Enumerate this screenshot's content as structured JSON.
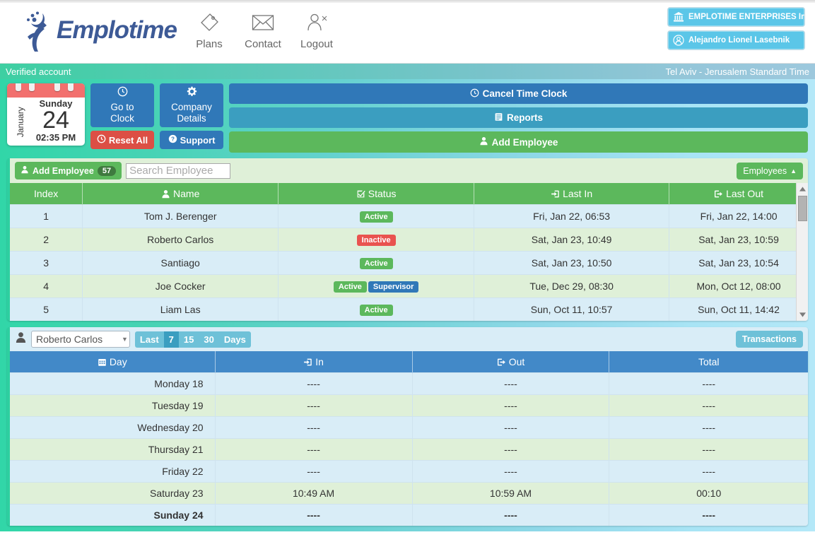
{
  "header": {
    "logo_text": "Emplotime",
    "nav": [
      {
        "label": "Plans",
        "icon": "tag-icon"
      },
      {
        "label": "Contact",
        "icon": "envelope-icon"
      },
      {
        "label": "Logout",
        "icon": "user-logout-icon"
      }
    ],
    "account": {
      "company": "EMPLOTIME ENTERPRISES Indu",
      "user": "Alejandro Lionel Lasebnik"
    }
  },
  "status_bar": {
    "verified": "Verified account",
    "timezone": "Tel Aviv - Jerusalem Standard Time"
  },
  "calendar": {
    "month": "January",
    "weekday": "Sunday",
    "day": "24",
    "time": "02:35 PM"
  },
  "controls": {
    "go_to_clock": "Go to\nClock",
    "go_to_clock_line1": "Go to",
    "go_to_clock_line2": "Clock",
    "company_details_line1": "Company",
    "company_details_line2": "Details",
    "reset_all": "Reset All",
    "support": "Support",
    "cancel_time_clock": "Cancel Time Clock",
    "reports": "Reports",
    "add_employee": "Add Employee"
  },
  "employees_panel": {
    "add_employee_label": "Add Employee",
    "count_badge": "57",
    "search_placeholder": "Search Employee",
    "search_value": "",
    "toggle_label": "Employees",
    "toggle_caret": "▲",
    "columns": [
      "Index",
      "Name",
      "Status",
      "Last In",
      "Last Out"
    ],
    "rows": [
      {
        "index": "1",
        "name": "Tom J. Berenger",
        "status": [
          "Active"
        ],
        "last_in": "Fri, Jan 22, 06:53",
        "last_out": "Fri, Jan 22, 14:00"
      },
      {
        "index": "2",
        "name": "Roberto Carlos",
        "status": [
          "Inactive"
        ],
        "last_in": "Sat, Jan 23, 10:49",
        "last_out": "Sat, Jan 23, 10:59"
      },
      {
        "index": "3",
        "name": "Santiago",
        "status": [
          "Active"
        ],
        "last_in": "Sat, Jan 23, 10:50",
        "last_out": "Sat, Jan 23, 10:54"
      },
      {
        "index": "4",
        "name": "Joe Cocker",
        "status": [
          "Active",
          "Supervisor"
        ],
        "last_in": "Tue, Dec 29, 08:30",
        "last_out": "Mon, Oct 12, 08:00"
      },
      {
        "index": "5",
        "name": "Liam Las",
        "status": [
          "Active"
        ],
        "last_in": "Sun, Oct 11, 10:57",
        "last_out": "Sun, Oct 11, 14:42"
      }
    ]
  },
  "transactions_panel": {
    "selected_employee": "Roberto Carlos",
    "employee_options": [
      "Roberto Carlos"
    ],
    "range_prefix": "Last",
    "range_options": [
      "7",
      "15",
      "30"
    ],
    "range_selected": "7",
    "range_suffix": "Days",
    "toggle_label": "Transactions",
    "columns": [
      "Day",
      "In",
      "Out",
      "Total"
    ],
    "rows": [
      {
        "day": "Monday 18",
        "in": "----",
        "out": "----",
        "total": "----",
        "today": false
      },
      {
        "day": "Tuesday 19",
        "in": "----",
        "out": "----",
        "total": "----",
        "today": false
      },
      {
        "day": "Wednesday 20",
        "in": "----",
        "out": "----",
        "total": "----",
        "today": false
      },
      {
        "day": "Thursday 21",
        "in": "----",
        "out": "----",
        "total": "----",
        "today": false
      },
      {
        "day": "Friday 22",
        "in": "----",
        "out": "----",
        "total": "----",
        "today": false
      },
      {
        "day": "Saturday 23",
        "in": "10:49 AM",
        "out": "10:59 AM",
        "total": "00:10",
        "today": false
      },
      {
        "day": "Sunday 24",
        "in": "----",
        "out": "----",
        "total": "----",
        "today": true
      }
    ]
  },
  "colors": {
    "brand_blue": "#3d5a96",
    "accent_teal": "#2ecfa0",
    "primary_blue": "#3078b8",
    "success_green": "#5cb85c",
    "danger_red": "#dc4f45",
    "info_blue": "#3b9ec0",
    "light_blue": "#5bc6e8"
  }
}
